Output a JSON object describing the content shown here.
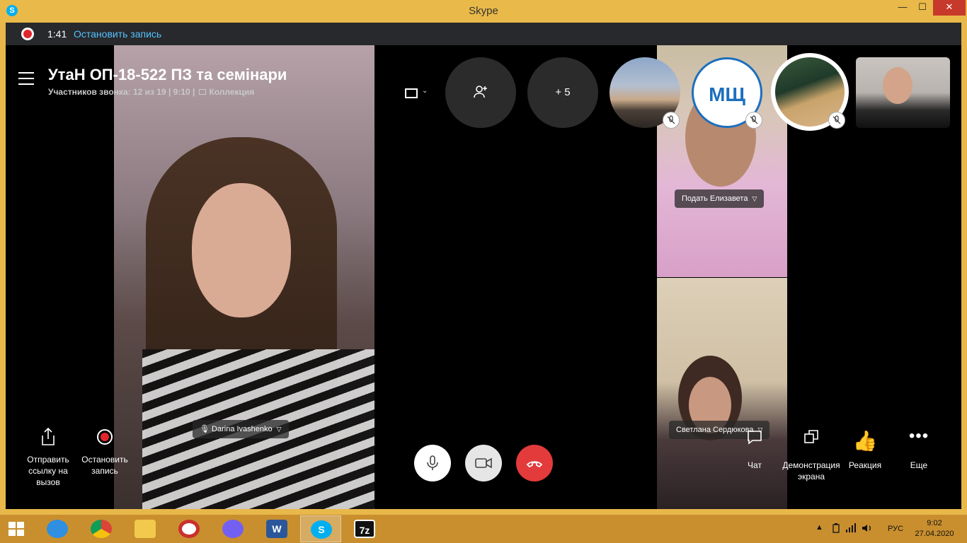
{
  "window": {
    "app_icon": "S",
    "title": "Skype",
    "min_glyph": "—",
    "max_glyph": "☐",
    "close_glyph": "✕"
  },
  "recording_bar": {
    "time": "1:41",
    "stop_label": "Остановить запись"
  },
  "call": {
    "title": "УтаН ОП-18-522 ПЗ та семінари",
    "meta": "Участников звонка: 12 из 19 | 9:10 |",
    "collection_label": "Коллекция"
  },
  "top_controls": {
    "layout_chevron": "⌄",
    "more_participants": "+ 5",
    "avatar_initials": "МЩ"
  },
  "participants": {
    "main_name": "Darina Ivashenko",
    "right_top_name": "Подать Елизавета",
    "right_bottom_name": "Светлана Сердюкова"
  },
  "left_actions": {
    "share_label": "Отправить ссылку на вызов",
    "stop_rec_label": "Остановить запись"
  },
  "right_actions": {
    "chat_label": "Чат",
    "screen_share_label": "Демонстрация экрана",
    "reaction_label": "Реакция",
    "reaction_glyph": "👍",
    "more_label": "Еще",
    "more_glyph": "•••"
  },
  "taskbar": {
    "word_glyph": "W",
    "skype_glyph": "S",
    "sevenzip_glyph": "7z",
    "tray_arrow": "▲",
    "language": "РУС",
    "time": "9:02",
    "date": "27.04.2020"
  },
  "colors": {
    "accent": "#00aff0",
    "record_red": "#e0262c",
    "end_call": "#e33b3b",
    "frame": "#e9b949",
    "link": "#55c1ff"
  }
}
